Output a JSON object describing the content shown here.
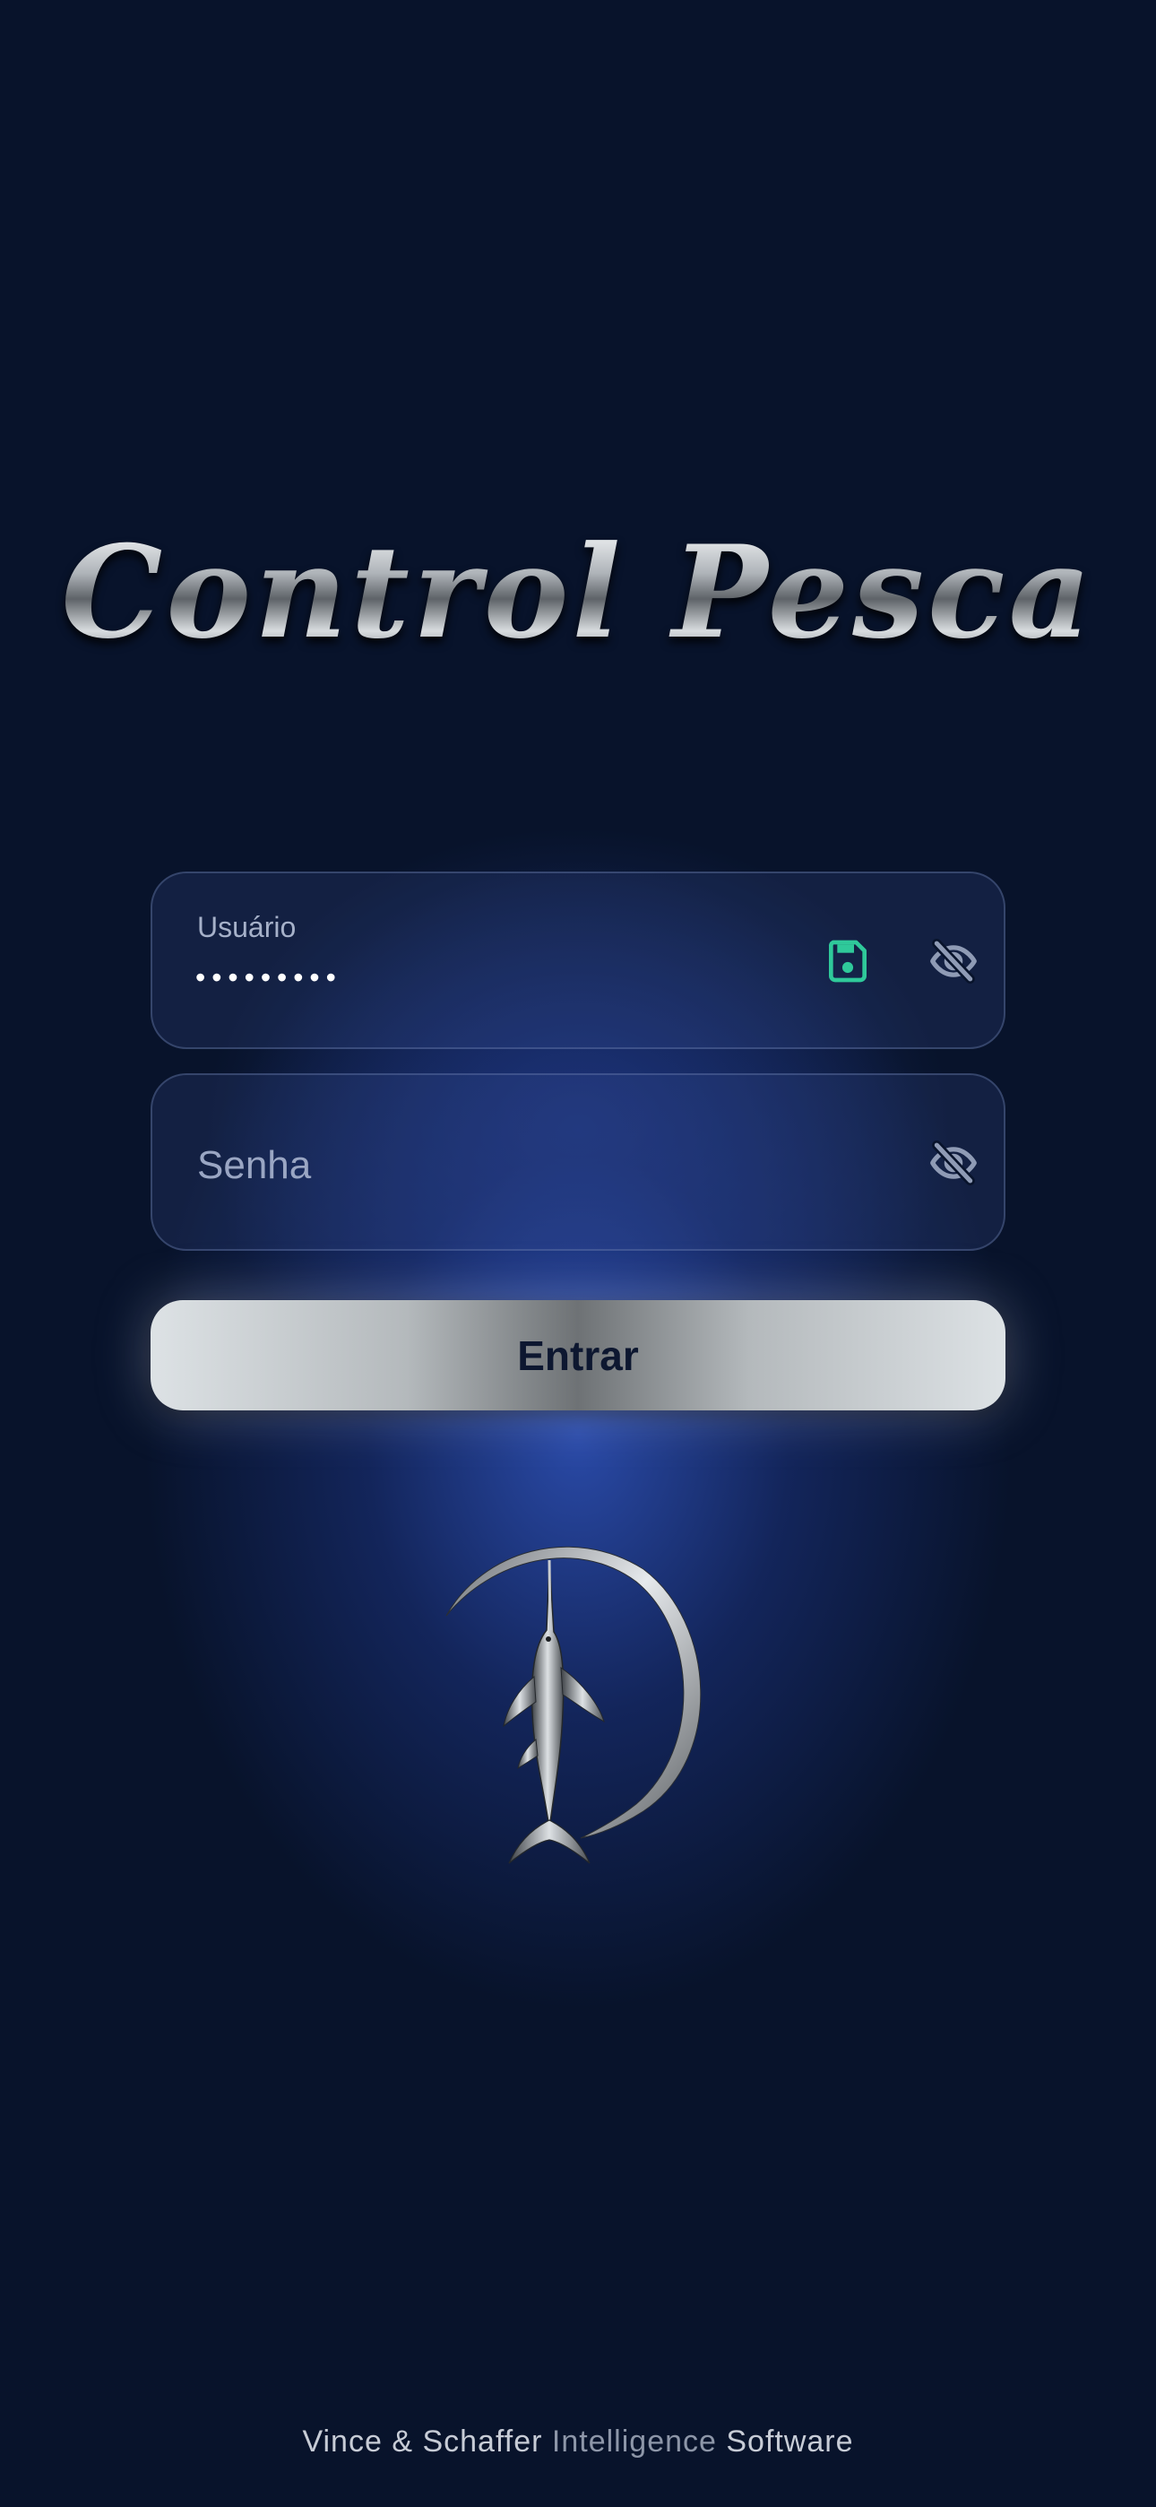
{
  "app": {
    "title": "Control Pesca"
  },
  "form": {
    "username": {
      "label": "Usuário",
      "value": "•••••••••",
      "icons": [
        "save-icon",
        "eye-off-icon"
      ]
    },
    "password": {
      "placeholder": "Senha",
      "icons": [
        "eye-off-icon"
      ]
    },
    "submit_label": "Entrar"
  },
  "logo": {
    "icon": "marlin-logo"
  },
  "footer": {
    "part1": "Vince & Schaffer ",
    "part2": "Intelligence",
    "part3": " Software"
  },
  "colors": {
    "background": "#08132b",
    "accent_green": "#2fc99a",
    "icon_gray": "#8f9bb5",
    "button_text": "#0d1730"
  }
}
